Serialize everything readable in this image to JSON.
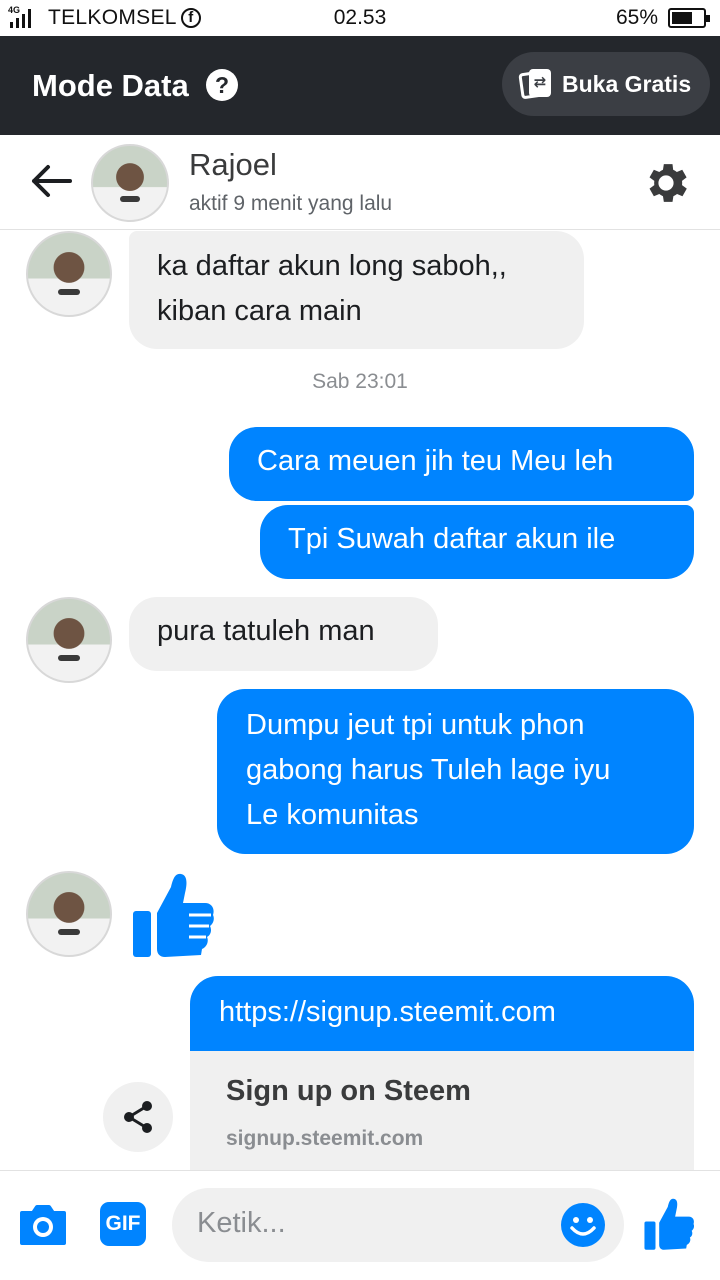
{
  "status_bar": {
    "network_type": "4G",
    "carrier": "TELKOMSEL",
    "time": "02.53",
    "battery_percent": "65%",
    "battery_level": 0.65,
    "signal_bars": 4
  },
  "data_mode": {
    "title": "Mode Data",
    "help_symbol": "?",
    "open_free_label": "Buka Gratis"
  },
  "conversation": {
    "contact_name": "Rajoel",
    "contact_status": "aktif 9 menit yang lalu"
  },
  "messages": {
    "m1_line1": "ka daftar akun long saboh,,",
    "m1_line2": "kiban cara main",
    "timestamp": "Sab 23:01",
    "m2": "Cara meuen jih teu Meu leh",
    "m3": "Tpi Suwah daftar akun ile",
    "m4": "pura tatuleh man",
    "m5_line1": "Dumpu jeut tpi untuk phon",
    "m5_line2": "gabong harus Tuleh lage iyu",
    "m5_line3": "Le komunitas",
    "link_url": "https://signup.steemit.com",
    "link_title": "Sign up on Steem",
    "link_domain": "signup.steemit.com"
  },
  "composer": {
    "placeholder": "Ketik...",
    "gif_label": "GIF"
  },
  "icons": {
    "back": "arrow-left-icon",
    "settings": "gear-icon",
    "like": "thumbs-up-icon",
    "camera": "camera-icon",
    "emoji": "smiley-icon",
    "share": "share-icon"
  },
  "colors": {
    "accent": "#0084ff",
    "incoming_bubble": "#f0f0f0",
    "data_mode_bar": "#24272c"
  }
}
